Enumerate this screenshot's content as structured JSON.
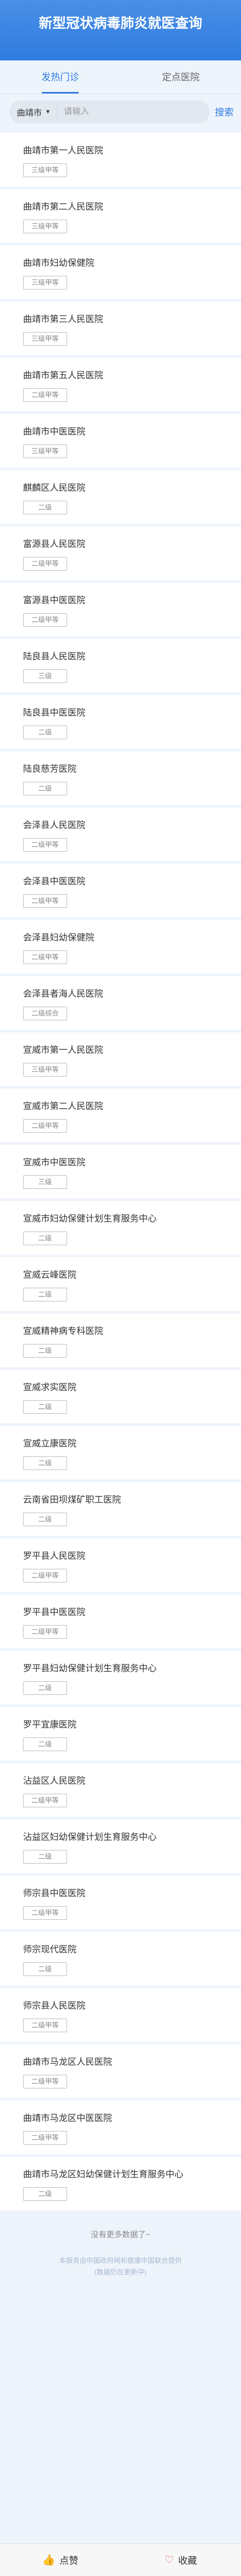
{
  "header": {
    "title": "新型冠状病毒肺炎就医查询"
  },
  "tabs": [
    {
      "label": "发热门诊"
    },
    {
      "label": "定点医院"
    }
  ],
  "search": {
    "city": "曲靖市",
    "placeholder": "请输入",
    "button": "搜索"
  },
  "hospitals": [
    {
      "name": "曲靖市第一人民医院",
      "level": "三级甲等"
    },
    {
      "name": "曲靖市第二人民医院",
      "level": "三级甲等"
    },
    {
      "name": "曲靖市妇幼保健院",
      "level": "三级甲等"
    },
    {
      "name": "曲靖市第三人民医院",
      "level": "三级甲等"
    },
    {
      "name": "曲靖市第五人民医院",
      "level": "二级甲等"
    },
    {
      "name": "曲靖市中医医院",
      "level": "三级甲等"
    },
    {
      "name": "麒麟区人民医院",
      "level": "二级"
    },
    {
      "name": "富源县人民医院",
      "level": "二级甲等"
    },
    {
      "name": "富源县中医医院",
      "level": "二级甲等"
    },
    {
      "name": "陆良县人民医院",
      "level": "三级"
    },
    {
      "name": "陆良县中医医院",
      "level": "二级"
    },
    {
      "name": "陆良慈芳医院",
      "level": "二级"
    },
    {
      "name": "会泽县人民医院",
      "level": "二级甲等"
    },
    {
      "name": "会泽县中医医院",
      "level": "二级甲等"
    },
    {
      "name": "会泽县妇幼保健院",
      "level": "二级甲等"
    },
    {
      "name": "会泽县者海人民医院",
      "level": "二级综合"
    },
    {
      "name": "宣威市第一人民医院",
      "level": "三级甲等"
    },
    {
      "name": "宣威市第二人民医院",
      "level": "二级甲等"
    },
    {
      "name": "宣威市中医医院",
      "level": "三级"
    },
    {
      "name": "宣威市妇幼保健计划生育服务中心",
      "level": "二级"
    },
    {
      "name": "宣威云峰医院",
      "level": "二级"
    },
    {
      "name": "宣威精神病专科医院",
      "level": "二级"
    },
    {
      "name": "宣威求实医院",
      "level": "二级"
    },
    {
      "name": "宣威立康医院",
      "level": "二级"
    },
    {
      "name": "云南省田坝煤矿职工医院",
      "level": "二级"
    },
    {
      "name": "罗平县人民医院",
      "level": "二级甲等"
    },
    {
      "name": "罗平县中医医院",
      "level": "二级甲等"
    },
    {
      "name": "罗平县妇幼保健计划生育服务中心",
      "level": "二级"
    },
    {
      "name": "罗平宜康医院",
      "level": "二级"
    },
    {
      "name": "沾益区人民医院",
      "level": "二级甲等"
    },
    {
      "name": "沾益区妇幼保健计划生育服务中心",
      "level": "二级"
    },
    {
      "name": "师宗县中医医院",
      "level": "二级甲等"
    },
    {
      "name": "师宗现代医院",
      "level": "二级"
    },
    {
      "name": "师宗县人民医院",
      "level": "二级甲等"
    },
    {
      "name": "曲靖市马龙区人民医院",
      "level": "二级甲等"
    },
    {
      "name": "曲靖市马龙区中医医院",
      "level": "二级甲等"
    },
    {
      "name": "曲靖市马龙区妇幼保健计划生育服务中心",
      "level": "二级"
    }
  ],
  "footer": {
    "no_more": "没有更多数据了~",
    "disclaimer_line1": "本服务由中国政府网和健康中国联合提供",
    "disclaimer_line2": "(数据仍在更新中)"
  },
  "bottom_bar": {
    "like_label": "点赞",
    "favorite_label": "收藏"
  },
  "colors": {
    "primary": "#2f7be0",
    "background": "#eef4fb"
  },
  "icons": {
    "like": "thumbs-up-icon",
    "favorite": "heart-icon",
    "caret": "caret-down-icon"
  }
}
